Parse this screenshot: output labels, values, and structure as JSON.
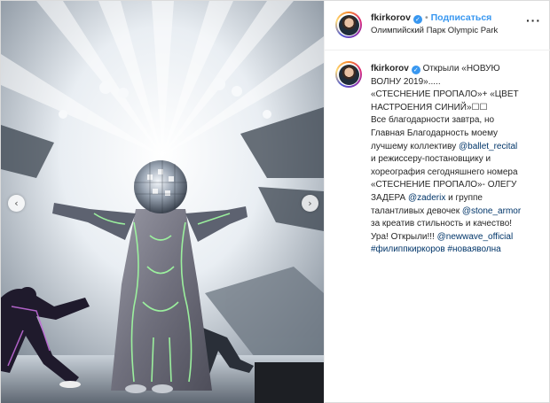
{
  "post": {
    "username": "fkirkorov",
    "verified_mark": "✓",
    "separator": "•",
    "follow_label": "Подписаться",
    "location": "Олимпийский Парк Olympic Park",
    "more_label": "···",
    "icons": {
      "prev": "chevron-left-icon",
      "next": "chevron-right-icon",
      "more": "more-options-icon",
      "verified": "verified-badge-icon"
    },
    "nav": {
      "prev_glyph": "‹",
      "next_glyph": "›"
    }
  },
  "caption": {
    "username": "fkirkorov",
    "lines": [
      [
        {
          "t": "Открыли «НОВУЮ"
        }
      ],
      [
        {
          "t": "ВОЛНУ 2019»....."
        }
      ],
      [
        {
          "t": "«СТЕСНЕНИЕ ПРОПАЛО»+ «ЦВЕТ"
        }
      ],
      [
        {
          "t": "НАСТРОЕНИЯ СИНИЙ»☐☐"
        }
      ],
      [
        {
          "t": "Все благодарности завтра, но"
        }
      ],
      [
        {
          "t": "Главная Благодарность моему"
        }
      ],
      [
        {
          "t": "лучшему коллективу "
        },
        {
          "t": "@ballet_recital",
          "m": true
        }
      ],
      [
        {
          "t": "и режиссеру-постановщику и"
        }
      ],
      [
        {
          "t": "хореография сегодняшнего номера"
        }
      ],
      [
        {
          "t": "«СТЕСНЕНИЕ ПРОПАЛО»- ОЛЕГУ"
        }
      ],
      [
        {
          "t": "ЗАДЕРА "
        },
        {
          "t": "@zaderix",
          "m": true
        },
        {
          "t": " и группе"
        }
      ],
      [
        {
          "t": "талантливых девочек "
        },
        {
          "t": "@stone_armor",
          "m": true
        }
      ],
      [
        {
          "t": "за креатив стильность и качество!"
        }
      ],
      [
        {
          "t": "Ура! Открыли!!! "
        },
        {
          "t": "@newwave_official",
          "m": true
        }
      ],
      [
        {
          "t": "#филиппкиркоров",
          "m": true
        },
        {
          "t": " "
        },
        {
          "t": "#новаяволна",
          "m": true
        }
      ]
    ]
  },
  "colors": {
    "link": "#003569",
    "follow": "#3897f0",
    "text": "#262626",
    "verified": "#3897f0"
  }
}
